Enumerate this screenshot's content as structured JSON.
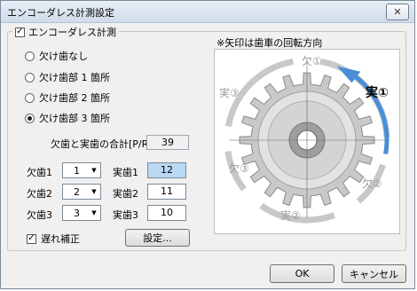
{
  "window": {
    "title": "エンコーダレス計測設定",
    "close_symbol": "✕"
  },
  "group": {
    "checkbox_label": "エンコーダレス計測",
    "checked": true
  },
  "radios": [
    {
      "label": "欠け歯なし",
      "checked": false
    },
    {
      "label": "欠け歯部 1 箇所",
      "checked": false
    },
    {
      "label": "欠け歯部 2 箇所",
      "checked": false
    },
    {
      "label": "欠け歯部 3 箇所",
      "checked": true
    }
  ],
  "total": {
    "label": "欠歯と実歯の合計[P/R]",
    "value": "39"
  },
  "rows": [
    {
      "missing_label": "欠歯1",
      "missing_value": "1",
      "real_label": "実歯1",
      "real_value": "12"
    },
    {
      "missing_label": "欠歯2",
      "missing_value": "2",
      "real_label": "実歯2",
      "real_value": "11"
    },
    {
      "missing_label": "欠歯3",
      "missing_value": "3",
      "real_label": "実歯3",
      "real_value": "10"
    }
  ],
  "delay": {
    "label": "遅れ補正",
    "checked": true
  },
  "buttons": {
    "settings": "設定...",
    "ok": "OK",
    "cancel": "キャンセル"
  },
  "diagram": {
    "note": "※矢印は歯車の回転方向",
    "labels": {
      "missing1": "欠①",
      "real1": "実①",
      "missing2": "欠②",
      "real2": "実②",
      "missing3": "欠③",
      "real3": "実③"
    },
    "colors": {
      "arrow": "#4a8ed6",
      "segment": "#c8c8c8",
      "gear": "#c9c9c9"
    }
  }
}
